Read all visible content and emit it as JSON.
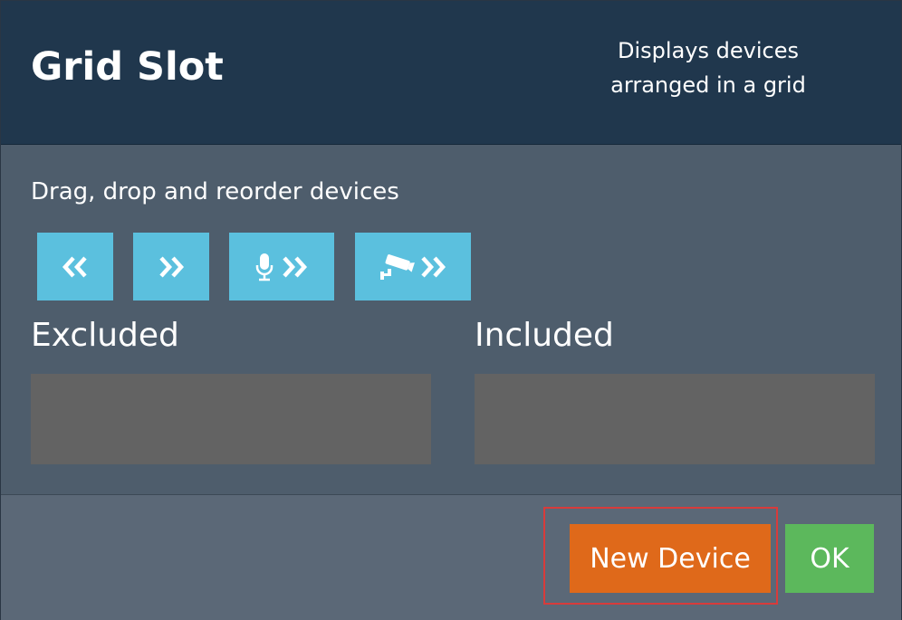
{
  "header": {
    "title": "Grid Slot",
    "subtitle": "Displays devices arranged in a grid"
  },
  "body": {
    "instructions": "Drag, drop and reorder devices",
    "toolbar": [
      {
        "name": "move-all-left-button",
        "icons": [
          "double-chevron-left-icon"
        ]
      },
      {
        "name": "move-all-right-button",
        "icons": [
          "double-chevron-right-icon"
        ]
      },
      {
        "name": "move-microphones-right-button",
        "icons": [
          "microphone-icon",
          "double-chevron-right-icon"
        ]
      },
      {
        "name": "move-cameras-right-button",
        "icons": [
          "security-camera-icon",
          "double-chevron-right-icon"
        ]
      }
    ],
    "excluded_label": "Excluded",
    "included_label": "Included",
    "excluded_items": [],
    "included_items": []
  },
  "footer": {
    "new_device_label": "New Device",
    "ok_label": "OK"
  },
  "colors": {
    "header_bg": "#20374d",
    "body_bg": "#4e5d6c",
    "footer_bg": "#5b6877",
    "toolbar_button": "#5bc0de",
    "list_bg": "#636363",
    "new_device_button": "#df691a",
    "ok_button": "#5cb85c",
    "highlight_border": "#d83b3b"
  }
}
